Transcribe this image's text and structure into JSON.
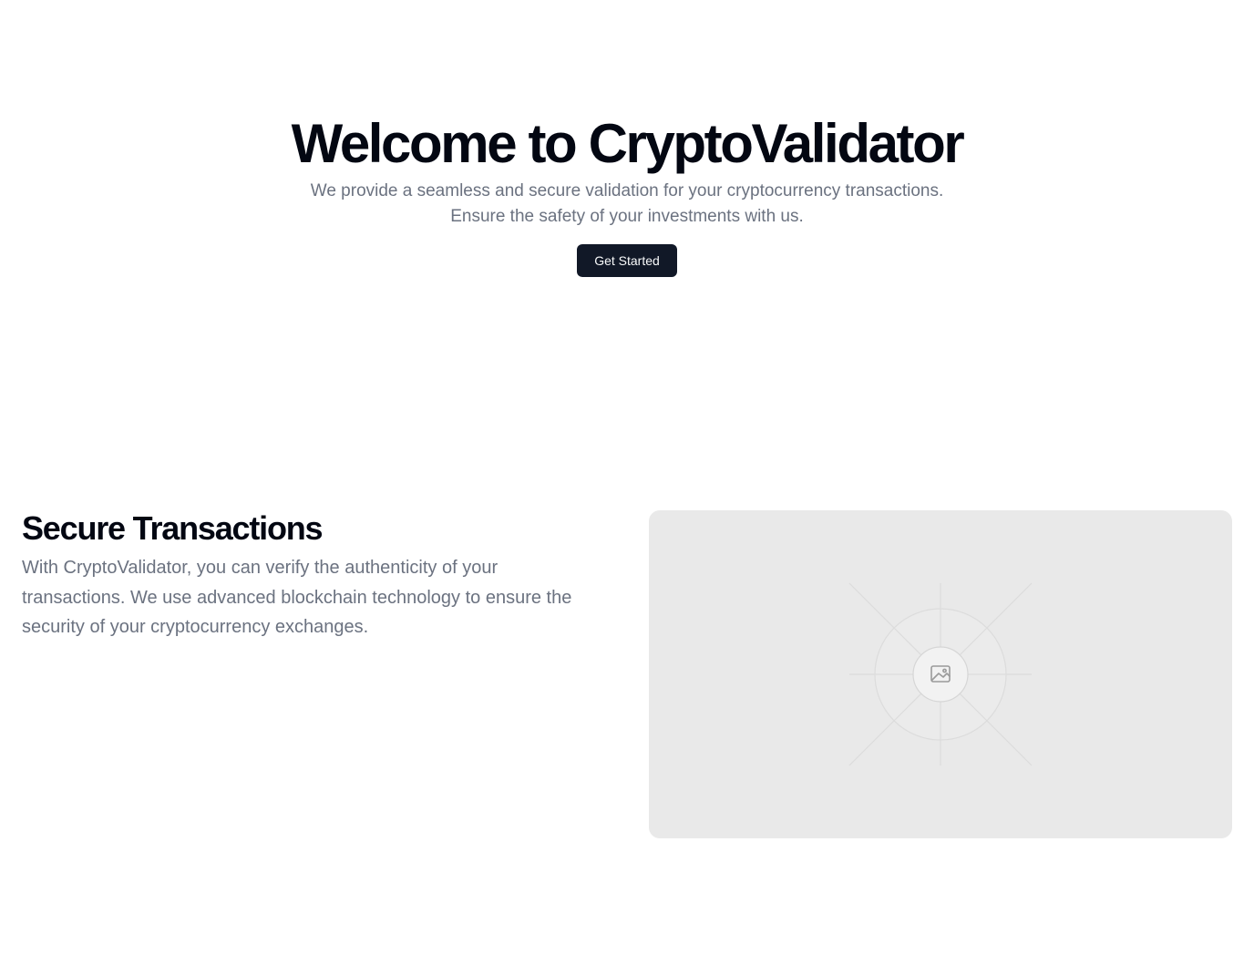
{
  "hero": {
    "title": "Welcome to CryptoValidator",
    "subtitle": "We provide a seamless and secure validation for your cryptocurrency transactions. Ensure the safety of your investments with us.",
    "cta_label": "Get Started"
  },
  "feature": {
    "title": "Secure Transactions",
    "description": "With CryptoValidator, you can verify the authenticity of your transactions. We use advanced blockchain technology to ensure the security of your cryptocurrency exchanges.",
    "image_icon": "image-icon"
  },
  "colors": {
    "button_bg": "#111827",
    "heading": "#030712",
    "body_text": "#6b7280",
    "placeholder_bg": "#e9e9e9"
  }
}
